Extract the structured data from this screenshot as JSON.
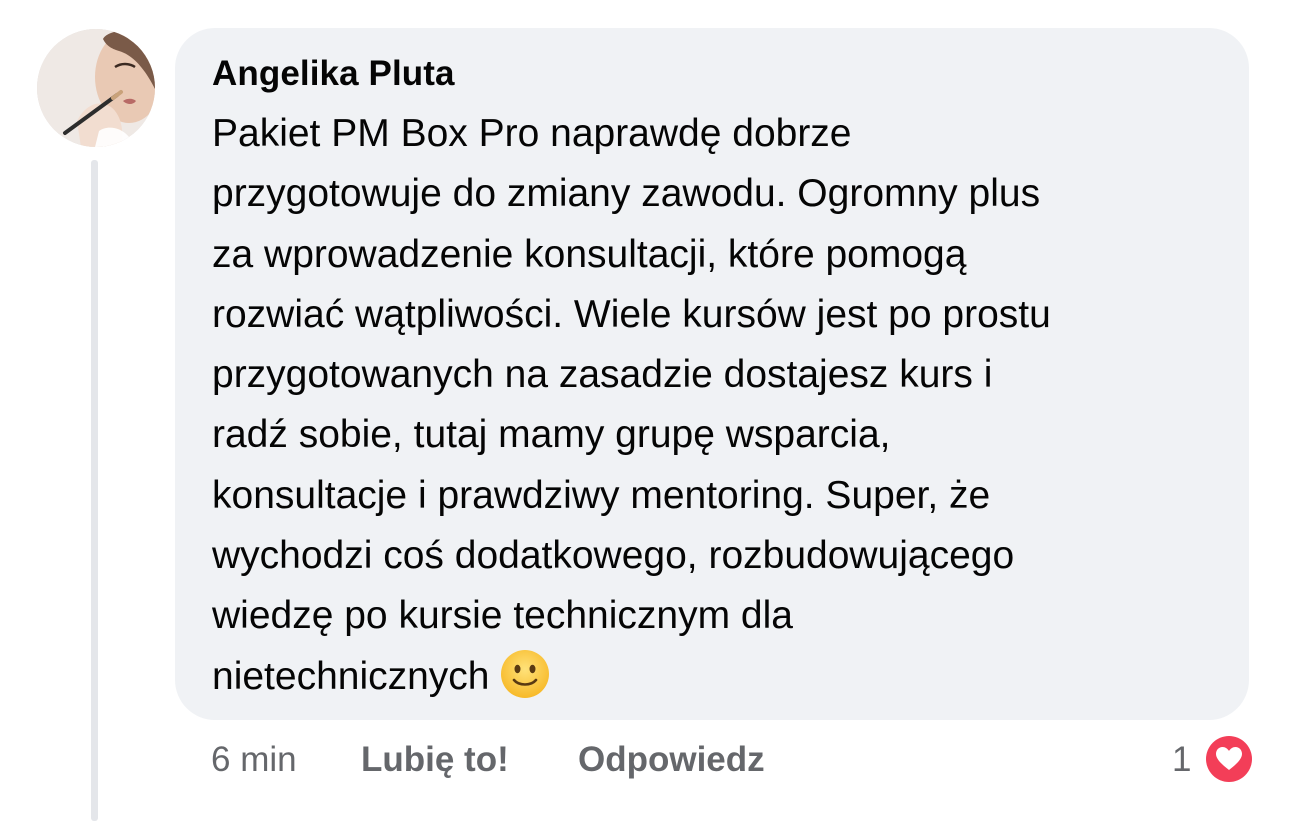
{
  "comment": {
    "author": "Angelika Pluta",
    "text_lines": [
      "Pakiet PM Box Pro naprawdę dobrze",
      "przygotowuje do zmiany zawodu. Ogromny plus",
      "za wprowadzenie konsultacji, które pomogą",
      "rozwiać wątpliwości. Wiele kursów jest po prostu",
      "przygotowanych na zasadzie dostajesz kurs i",
      "radź sobie, tutaj mamy grupę wsparcia,",
      "konsultacje i prawdziwy mentoring. Super, że",
      "wychodzi coś dodatkowego, rozbudowującego",
      "wiedzę po kursie technicznym dla",
      "nietechnicznych"
    ],
    "emoji": "slightly-smiling-face-icon",
    "timestamp": "6 min",
    "like_label": "Lubię to!",
    "reply_label": "Odpowiedz",
    "reaction_count": "1",
    "reaction_type": "heart-icon"
  },
  "colors": {
    "bubble": "#f0f2f5",
    "text": "#050505",
    "secondary_text": "#65676b",
    "heart": "#f33e58",
    "thread_line": "#e4e6ea"
  }
}
